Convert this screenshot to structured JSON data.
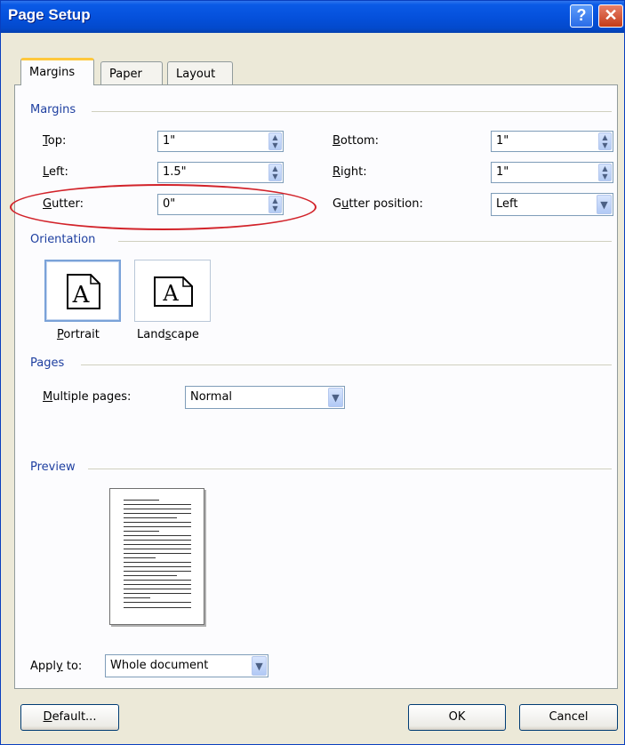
{
  "window": {
    "title": "Page Setup",
    "help_label": "?",
    "close_label": "✕"
  },
  "tabs": [
    {
      "label": "Margins",
      "active": true
    },
    {
      "label": "Paper"
    },
    {
      "label": "Layout"
    }
  ],
  "margins": {
    "group_label": "Margins",
    "top": {
      "label_prefix": "",
      "label_key": "T",
      "label_rest": "op:",
      "value": "1\""
    },
    "left": {
      "label_prefix": "",
      "label_key": "L",
      "label_rest": "eft:",
      "value": "1.5\""
    },
    "gutter": {
      "label_prefix": "",
      "label_key": "G",
      "label_rest": "utter:",
      "value": "0\""
    },
    "bottom": {
      "label_prefix": "",
      "label_key": "B",
      "label_rest": "ottom:",
      "value": "1\""
    },
    "right": {
      "label_prefix": "",
      "label_key": "R",
      "label_rest": "ight:",
      "value": "1\""
    },
    "gutter_position": {
      "label_prefix": "G",
      "label_key": "u",
      "label_rest": "tter position:",
      "value": "Left"
    }
  },
  "orientation": {
    "group_label": "Orientation",
    "glyph": "A",
    "portrait": {
      "label_prefix": "",
      "label_key": "P",
      "label_rest": "ortrait"
    },
    "landscape": {
      "label_prefix": "Land",
      "label_key": "s",
      "label_rest": "cape"
    }
  },
  "pages": {
    "group_label": "Pages",
    "multiple_pages": {
      "label_prefix": "",
      "label_key": "M",
      "label_rest": "ultiple pages:",
      "value": "Normal"
    }
  },
  "preview": {
    "group_label": "Preview"
  },
  "apply_to": {
    "label_prefix": "Appl",
    "label_key": "y",
    "label_rest": " to:",
    "value": "Whole document"
  },
  "buttons": {
    "default": {
      "label_prefix": "",
      "label_key": "D",
      "label_rest": "efault..."
    },
    "ok": "OK",
    "cancel": "Cancel"
  },
  "colors": {
    "title_bar": "#0551dc",
    "group_label": "#1e3fa0",
    "annotation": "#d2232a"
  }
}
